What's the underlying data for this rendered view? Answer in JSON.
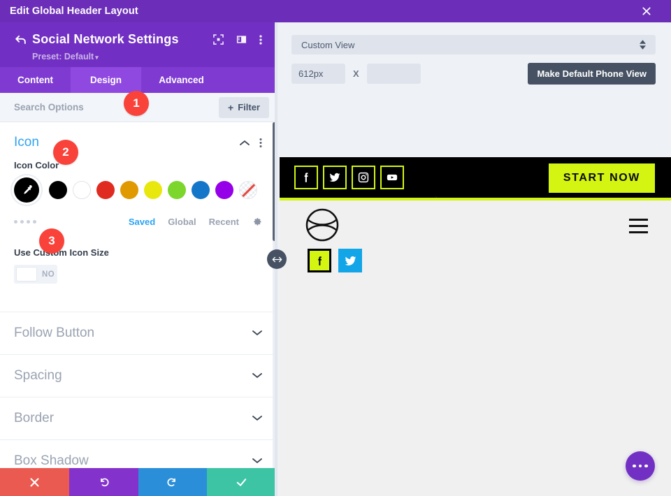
{
  "modal": {
    "title": "Edit Global Header Layout",
    "close_icon": "close-icon"
  },
  "panel": {
    "back_icon": "back-arrow-icon",
    "title": "Social Network Settings",
    "preset_label": "Preset: Default",
    "preset_caret": "▾",
    "header_icons": [
      "focus-frame-icon",
      "layout-panel-icon",
      "kebab-menu-icon"
    ],
    "tabs": [
      {
        "label": "Content",
        "active": false
      },
      {
        "label": "Design",
        "active": true
      },
      {
        "label": "Advanced",
        "active": false
      }
    ],
    "search": {
      "placeholder": "Search Options",
      "value": ""
    },
    "filter": {
      "label": "Filter",
      "plus": "+"
    }
  },
  "icon_section": {
    "title": "Icon",
    "collapse_icon": "chevron-up-icon",
    "more_icon": "kebab-menu-icon",
    "icon_color_label": "Icon Color",
    "selected_swatch_color": "#000000",
    "eyedropper_icon": "eyedropper-icon",
    "swatches": [
      {
        "name": "black",
        "color": "#000000"
      },
      {
        "name": "white",
        "color": "#ffffff"
      },
      {
        "name": "red",
        "color": "#e02b20"
      },
      {
        "name": "orange",
        "color": "#e09900"
      },
      {
        "name": "yellow",
        "color": "#e8e80e"
      },
      {
        "name": "green",
        "color": "#7cd62c"
      },
      {
        "name": "blue",
        "color": "#1476c8"
      },
      {
        "name": "purple",
        "color": "#9500e8"
      },
      {
        "name": "transparent",
        "color": "transparent"
      }
    ],
    "preset_dots_icon": "preset-dots-icon",
    "palette_tabs": [
      {
        "label": "Saved",
        "active": true
      },
      {
        "label": "Global",
        "active": false
      },
      {
        "label": "Recent",
        "active": false
      }
    ],
    "settings_icon": "gear-icon",
    "custom_icon_size": {
      "label": "Use Custom Icon Size",
      "value": "NO"
    }
  },
  "collapsed_sections": [
    {
      "label": "Follow Button",
      "chevron": "chevron-down-icon"
    },
    {
      "label": "Spacing",
      "chevron": "chevron-down-icon"
    },
    {
      "label": "Border",
      "chevron": "chevron-down-icon"
    },
    {
      "label": "Box Shadow",
      "chevron": "chevron-down-icon"
    }
  ],
  "badges": [
    {
      "number": "1"
    },
    {
      "number": "2"
    },
    {
      "number": "3"
    }
  ],
  "bottom_bar": [
    {
      "name": "cancel",
      "icon": "close-icon",
      "color": "#ea5a51"
    },
    {
      "name": "undo",
      "icon": "undo-icon",
      "color": "#8332cc"
    },
    {
      "name": "redo",
      "icon": "redo-icon",
      "color": "#2a8fd8"
    },
    {
      "name": "save",
      "icon": "check-icon",
      "color": "#3dc4a4"
    }
  ],
  "preview": {
    "view_select": {
      "value": "Custom View",
      "spinner_icon": "spinner-arrows-icon"
    },
    "width_value": "612px",
    "height_value": "",
    "height_placeholder": "",
    "multiply_symbol": "X",
    "make_default_label": "Make Default Phone View",
    "resize_handle_icon": "horizontal-resize-icon",
    "site": {
      "topbar_socials": [
        {
          "name": "facebook-icon"
        },
        {
          "name": "twitter-icon"
        },
        {
          "name": "instagram-icon"
        },
        {
          "name": "youtube-icon"
        }
      ],
      "cta_label": "START NOW",
      "logo_icon": "circle-logo-icon",
      "menu_icon": "hamburger-menu-icon",
      "nav_socials": [
        {
          "name": "facebook-icon",
          "bg": "#d4f511"
        },
        {
          "name": "twitter-icon",
          "bg": "#12a5e8"
        }
      ],
      "accent_color": "#d4f511"
    },
    "fab_icon": "more-dots-icon"
  }
}
